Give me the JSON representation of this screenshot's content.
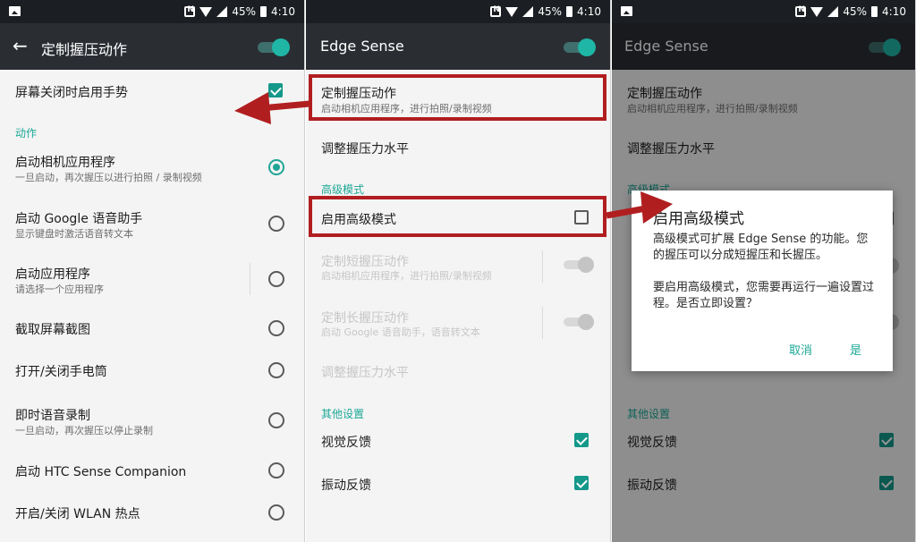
{
  "status": {
    "battery": "45%",
    "time": "4:10"
  },
  "screen1": {
    "title": "定制握压动作",
    "top_item": "屏幕关闭时启用手势",
    "section_actions": "动作",
    "options": [
      {
        "title": "启动相机应用程序",
        "subtitle": "一旦启动，再次握压以进行拍照 / 录制视频"
      },
      {
        "title": "启动 Google 语音助手",
        "subtitle": "显示键盘时激活语音转文本"
      },
      {
        "title": "启动应用程序",
        "subtitle": "请选择一个应用程序"
      },
      {
        "title": "截取屏幕截图",
        "subtitle": ""
      },
      {
        "title": "打开/关闭手电筒",
        "subtitle": ""
      },
      {
        "title": "即时语音录制",
        "subtitle": "一旦启动，再次握压以停止录制"
      },
      {
        "title": "启动 HTC Sense Companion",
        "subtitle": ""
      },
      {
        "title": "开启/关闭 WLAN 热点",
        "subtitle": ""
      }
    ],
    "selected_option": "启动相机应用程序"
  },
  "screen2": {
    "title": "Edge Sense",
    "custom_action": {
      "title": "定制握压动作",
      "subtitle": "启动相机应用程序，进行拍照/录制视频"
    },
    "adjust_level": "调整握压力水平",
    "section_advanced": "高级模式",
    "enable_advanced": "启用高级模式",
    "short_action": {
      "title": "定制短握压动作",
      "subtitle": "启动相机应用程序，进行拍照/录制视频"
    },
    "long_action": {
      "title": "定制长握压动作",
      "subtitle": "启动 Google 语音助手，语音转文本"
    },
    "adjust_level_disabled": "调整握压力水平",
    "section_other": "其他设置",
    "visual_feedback": "视觉反馈",
    "vibration_feedback": "振动反馈"
  },
  "screen3": {
    "title": "Edge Sense",
    "custom_action": {
      "title": "定制握压动作",
      "subtitle": "启动相机应用程序，进行拍照/录制视频"
    },
    "adjust_level": "调整握压力水平",
    "section_advanced": "高级模式",
    "section_other": "其他设置",
    "visual_feedback": "视觉反馈",
    "vibration_feedback": "振动反馈",
    "dialog": {
      "title": "启用高级模式",
      "body1": "高级模式可扩展 Edge Sense 的功能。您的握压可以分成短握压和长握压。",
      "body2": "要启用高级模式，您需要再运行一遍设置过程。是否立即设置？",
      "cancel": "取消",
      "confirm": "是"
    }
  },
  "colors": {
    "accent": "#1ca896",
    "annotation": "#b11e20",
    "appbar": "#2a2e33"
  }
}
